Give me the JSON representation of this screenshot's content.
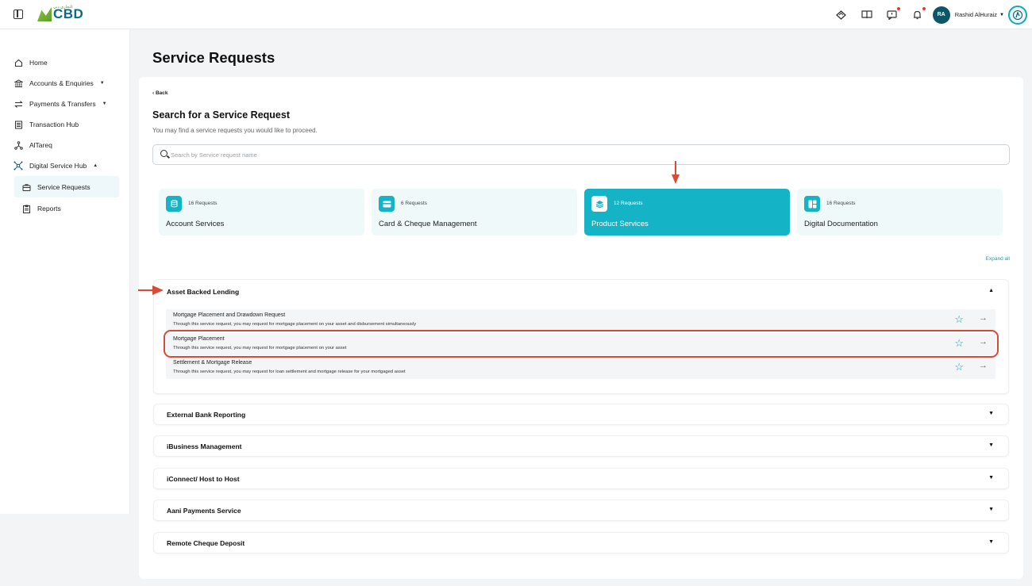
{
  "header": {
    "logo_text": "CBD",
    "logo_subtext": "التجاري دبي",
    "user_initials": "RA",
    "user_name": "Rashid AlHuraiz",
    "icons": [
      "panel-toggle-icon",
      "diamond-icon",
      "book-icon",
      "message-icon",
      "bell-icon"
    ]
  },
  "sidebar": {
    "items": [
      {
        "label": "Home",
        "icon": "home-icon"
      },
      {
        "label": "Accounts & Enquiries",
        "icon": "bank-icon"
      },
      {
        "label": "Payments & Transfers",
        "icon": "transfer-icon"
      },
      {
        "label": "Transaction Hub",
        "icon": "list-icon"
      },
      {
        "label": "AlTareq",
        "icon": "network-icon"
      },
      {
        "label": "Digital Service Hub",
        "icon": "hub-icon"
      },
      {
        "label": "Service Requests",
        "icon": "briefcase-icon"
      },
      {
        "label": "Reports",
        "icon": "report-icon"
      }
    ]
  },
  "page": {
    "title": "Service Requests",
    "back": "‹ Back",
    "search_title": "Search for a Service Request",
    "search_subtitle": "You may find a service requests you would like to proceed.",
    "search_placeholder": "Search by Service request name",
    "expand_all": "Expand all"
  },
  "categories": [
    {
      "count": "16 Requests",
      "name": "Account Services",
      "active": false
    },
    {
      "count": "6 Requests",
      "name": "Card & Cheque Management",
      "active": false
    },
    {
      "count": "12 Requests",
      "name": "Product Services",
      "active": true
    },
    {
      "count": "16 Requests",
      "name": "Digital Documentation",
      "active": false
    }
  ],
  "sections": [
    {
      "title": "Asset Backed Lending",
      "expanded": true,
      "requests": [
        {
          "title": "Mortgage Placement and Drawdown Request",
          "desc": "Through this service request, you may request for mortgage placement on your asset and disbursement simultaneously"
        },
        {
          "title": "Mortgage Placement",
          "desc": "Through this service request, you may request for mortgage placement on your asset"
        },
        {
          "title": "Settlement & Mortgage Release",
          "desc": "Through this service request, you may request for loan settlement and mortgage release for your mortgaged asset"
        }
      ]
    },
    {
      "title": "External Bank Reporting",
      "expanded": false
    },
    {
      "title": "iBusiness Management",
      "expanded": false
    },
    {
      "title": "iConnect/ Host to Host",
      "expanded": false
    },
    {
      "title": "Aani Payments Service",
      "expanded": false
    },
    {
      "title": "Remote Cheque Deposit",
      "expanded": false
    }
  ],
  "colors": {
    "accent": "#14b3c6",
    "annotation": "#d94a38",
    "dark": "#0f5568"
  }
}
